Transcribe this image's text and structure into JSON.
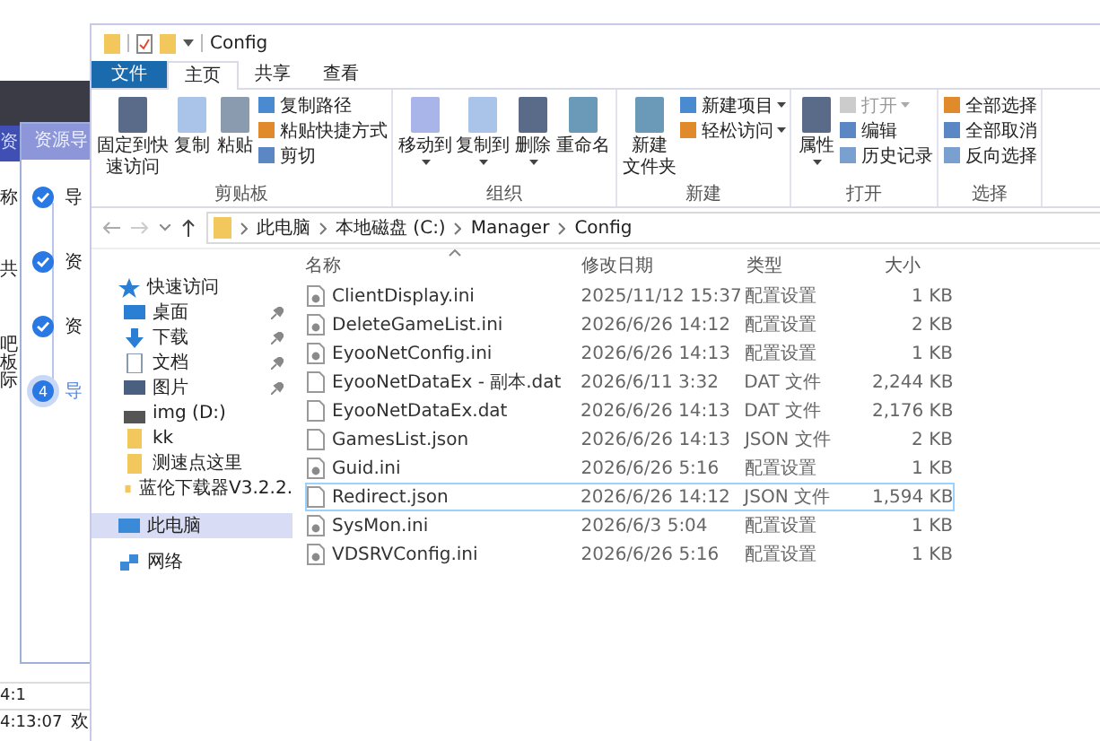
{
  "background_app": {
    "tab": "资",
    "dialog_title": "资源导",
    "side_texts": [
      "称",
      "共",
      "吧",
      "板",
      "际"
    ],
    "steps": [
      {
        "label": "导",
        "done": true
      },
      {
        "label": "资",
        "done": true
      },
      {
        "label": "资",
        "done": true
      },
      {
        "marker": "4",
        "label": "导",
        "done": false
      }
    ],
    "log_rows": [
      {
        "time": "4:1"
      },
      {
        "time": "4:13:07",
        "text": "欢"
      }
    ]
  },
  "window": {
    "title": "Config"
  },
  "tabs": [
    {
      "label": "文件",
      "selected": false,
      "kind": "file"
    },
    {
      "label": "主页",
      "selected": true,
      "kind": "tab"
    },
    {
      "label": "共享",
      "selected": false,
      "kind": "tab"
    },
    {
      "label": "查看",
      "selected": false,
      "kind": "tab"
    }
  ],
  "ribbon": [
    {
      "label": "剪贴板",
      "items": [
        {
          "kind": "large",
          "lines": [
            "固定到快",
            "速访问"
          ],
          "disabled": false
        },
        {
          "kind": "large",
          "lines": [
            "复制"
          ],
          "disabled": false
        },
        {
          "kind": "large",
          "lines": [
            "粘贴"
          ],
          "disabled": false
        },
        {
          "kind": "small",
          "lines": [
            "复制路径"
          ],
          "disabled": false
        },
        {
          "kind": "small",
          "lines": [
            "粘贴快捷方式"
          ],
          "disabled": false
        },
        {
          "kind": "small",
          "lines": [
            "剪切"
          ],
          "disabled": false
        }
      ]
    },
    {
      "label": "组织",
      "items": [
        {
          "kind": "large",
          "lines": [
            "移动到"
          ],
          "disabled": false,
          "caret": true
        },
        {
          "kind": "large",
          "lines": [
            "复制到"
          ],
          "disabled": false,
          "caret": true
        },
        {
          "kind": "large",
          "lines": [
            "删除"
          ],
          "disabled": false,
          "caret": true
        },
        {
          "kind": "large",
          "lines": [
            "重命名"
          ],
          "disabled": false
        }
      ]
    },
    {
      "label": "新建",
      "items": [
        {
          "kind": "large",
          "lines": [
            "新建",
            "文件夹"
          ],
          "disabled": false
        },
        {
          "kind": "small",
          "lines": [
            "新建项目"
          ],
          "disabled": false,
          "caret": true
        },
        {
          "kind": "small",
          "lines": [
            "轻松访问"
          ],
          "disabled": false,
          "caret": true
        }
      ]
    },
    {
      "label": "打开",
      "items": [
        {
          "kind": "large",
          "lines": [
            "属性"
          ],
          "disabled": false,
          "caret": true
        },
        {
          "kind": "small",
          "lines": [
            "打开"
          ],
          "disabled": true,
          "caret": true
        },
        {
          "kind": "small",
          "lines": [
            "编辑"
          ],
          "disabled": false
        },
        {
          "kind": "small",
          "lines": [
            "历史记录"
          ],
          "disabled": false
        }
      ]
    },
    {
      "label": "选择",
      "items": [
        {
          "kind": "small",
          "lines": [
            "全部选择"
          ],
          "disabled": false
        },
        {
          "kind": "small",
          "lines": [
            "全部取消"
          ],
          "disabled": false
        },
        {
          "kind": "small",
          "lines": [
            "反向选择"
          ],
          "disabled": false
        }
      ]
    }
  ],
  "address": {
    "crumbs": [
      "此电脑",
      "本地磁盘 (C:)",
      "Manager",
      "Config"
    ]
  },
  "nav": [
    {
      "label": "快速访问",
      "kind": "quick",
      "pinned": false,
      "selected": false
    },
    {
      "label": "桌面",
      "kind": "desktop",
      "pinned": true,
      "selected": false
    },
    {
      "label": "下载",
      "kind": "download",
      "pinned": true,
      "selected": false
    },
    {
      "label": "文档",
      "kind": "docs",
      "pinned": true,
      "selected": false
    },
    {
      "label": "图片",
      "kind": "pictures",
      "pinned": true,
      "selected": false
    },
    {
      "label": "img (D:)",
      "kind": "drive",
      "pinned": false,
      "selected": false
    },
    {
      "label": "kk",
      "kind": "folder",
      "pinned": false,
      "selected": false
    },
    {
      "label": "测速点这里",
      "kind": "folder",
      "pinned": false,
      "selected": false
    },
    {
      "label": "蓝伦下载器V3.2.2.",
      "kind": "folder",
      "pinned": false,
      "selected": false
    },
    {
      "label": "此电脑",
      "kind": "pc",
      "pinned": false,
      "selected": true
    },
    {
      "label": "网络",
      "kind": "network",
      "pinned": false,
      "selected": false
    }
  ],
  "table": {
    "columns": [
      "名称",
      "修改日期",
      "类型",
      "大小"
    ],
    "rows": [
      {
        "name": "ClientDisplay.ini",
        "date": "2025/11/12 15:37",
        "type": "配置设置",
        "size": "1 KB",
        "kind": "ini",
        "focused": false
      },
      {
        "name": "DeleteGameList.ini",
        "date": "2026/6/26 14:12",
        "type": "配置设置",
        "size": "2 KB",
        "kind": "ini",
        "focused": false
      },
      {
        "name": "EyooNetConfig.ini",
        "date": "2026/6/26 14:13",
        "type": "配置设置",
        "size": "1 KB",
        "kind": "ini",
        "focused": false
      },
      {
        "name": "EyooNetDataEx - 副本.dat",
        "date": "2026/6/11 3:32",
        "type": "DAT 文件",
        "size": "2,244 KB",
        "kind": "file",
        "focused": false
      },
      {
        "name": "EyooNetDataEx.dat",
        "date": "2026/6/26 14:13",
        "type": "DAT 文件",
        "size": "2,176 KB",
        "kind": "file",
        "focused": false
      },
      {
        "name": "GamesList.json",
        "date": "2026/6/26 14:13",
        "type": "JSON 文件",
        "size": "2 KB",
        "kind": "file",
        "focused": false
      },
      {
        "name": "Guid.ini",
        "date": "2026/6/26 5:16",
        "type": "配置设置",
        "size": "1 KB",
        "kind": "ini",
        "focused": false
      },
      {
        "name": "Redirect.json",
        "date": "2026/6/26 14:12",
        "type": "JSON 文件",
        "size": "1,594 KB",
        "kind": "file",
        "focused": true
      },
      {
        "name": "SysMon.ini",
        "date": "2026/6/3 5:04",
        "type": "配置设置",
        "size": "1 KB",
        "kind": "ini",
        "focused": false
      },
      {
        "name": "VDSRVConfig.ini",
        "date": "2026/6/26 5:16",
        "type": "配置设置",
        "size": "1 KB",
        "kind": "ini",
        "focused": false
      }
    ]
  }
}
